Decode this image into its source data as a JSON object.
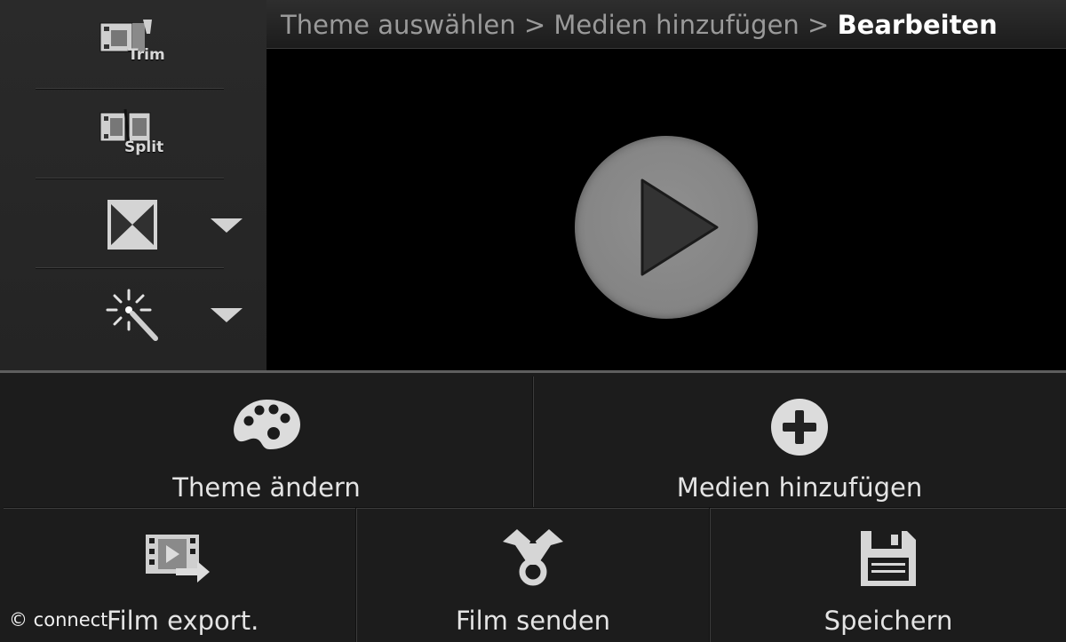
{
  "breadcrumb": {
    "step1": "Theme auswählen",
    "sep": ">",
    "step2": "Medien hinzufügen",
    "current": "Bearbeiten"
  },
  "sidebar": {
    "trim_label": "Trim",
    "split_label": "Split",
    "transition_icon": "bowtie-transition-icon",
    "effects_icon": "magic-wand-icon"
  },
  "preview": {
    "play_icon": "play-icon"
  },
  "actions": {
    "theme_label": "Theme ändern",
    "media_label": "Medien hinzufügen",
    "export_label": "Film export.",
    "send_label": "Film senden",
    "save_label": "Speichern"
  },
  "watermark": "© connect",
  "colors": {
    "background": "#141414",
    "panel": "#1c1c1c",
    "icon": "#d8d8d8",
    "play": "#8a8a8a"
  }
}
